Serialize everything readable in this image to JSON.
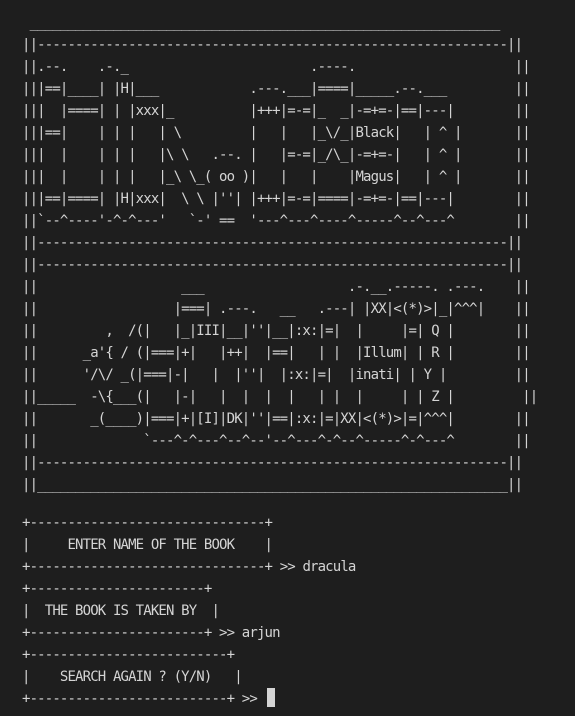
{
  "banner": {
    "art_lines": [
      " ______________________________________________________________",
      "||--------------------------------------------------------------||",
      "||.--.    .-._                        .----.                     ||",
      "|||==|____| |H|___            .---.___|====|_____.--.___         ||",
      "|||  |====| | |xxx|_          |+++|=-=|_  _|-=+=-|==|---|        ||",
      "|||==|    | | |   | \\         |   |   |_\\/_|Black|   | ^ |       ||",
      "|||  |    | | |   |\\ \\   .--. |   |=-=|_/\\_|-=+=-|   | ^ |       ||",
      "|||  |    | | |   |_\\ \\_( oo )|   |   |    |Magus|   | ^ |       ||",
      "|||==|====| |H|xxx|  \\ \\ |''| |+++|=-=|====|-=+=-|==|---|        ||",
      "||`--^----'-^-^---'   `-' ==  '---^---^----^-----^--^---^        ||",
      "||--------------------------------------------------------------||",
      "||--------------------------------------------------------------||",
      "||                   ___                   .-.__.-----. .---.    ||",
      "||                  |===| .---.   __   .---| |XX|<(*)>|_|^^^|    ||",
      "||         ,  /(|   |_|III|__|''|__|:x:|=|  |     |=| Q |        ||",
      "||      _a'{ / (|===|+|   |++|  |==|   | |  |Illum| | R |        ||",
      "||      '/\\/ _(|===|-|   |  |''|  |:x:|=|  |inati| | Y |         ||",
      "||_____  -\\{___(|   |-|   |  |  |  |   | |  |     | | Z |         ||",
      "||       _(____)|===|+|[I]|DK|''|==|:x:|=|XX|<(*)>|=|^^^|        ||",
      "||              `---^-^---^--^--'--^---^-^--^-----^-^---^        ||",
      "||--------------------------------------------------------------||",
      "||______________________________________________________________||"
    ]
  },
  "box1": {
    "top": "+-------------------------------+",
    "label": "|     ENTER NAME OF THE BOOK    |",
    "bottom": "+-------------------------------+",
    "prompt": " >> ",
    "value": "dracula"
  },
  "box2": {
    "top": "+-----------------------+",
    "label": "|  THE BOOK IS TAKEN BY  |",
    "bottom": "+-----------------------+",
    "prompt": " >> ",
    "value": "arjun"
  },
  "box3": {
    "top": "+--------------------------+",
    "label": "|    SEARCH AGAIN ? (Y/N)   |",
    "bottom": "+--------------------------+",
    "prompt": " >> ",
    "value": ""
  }
}
